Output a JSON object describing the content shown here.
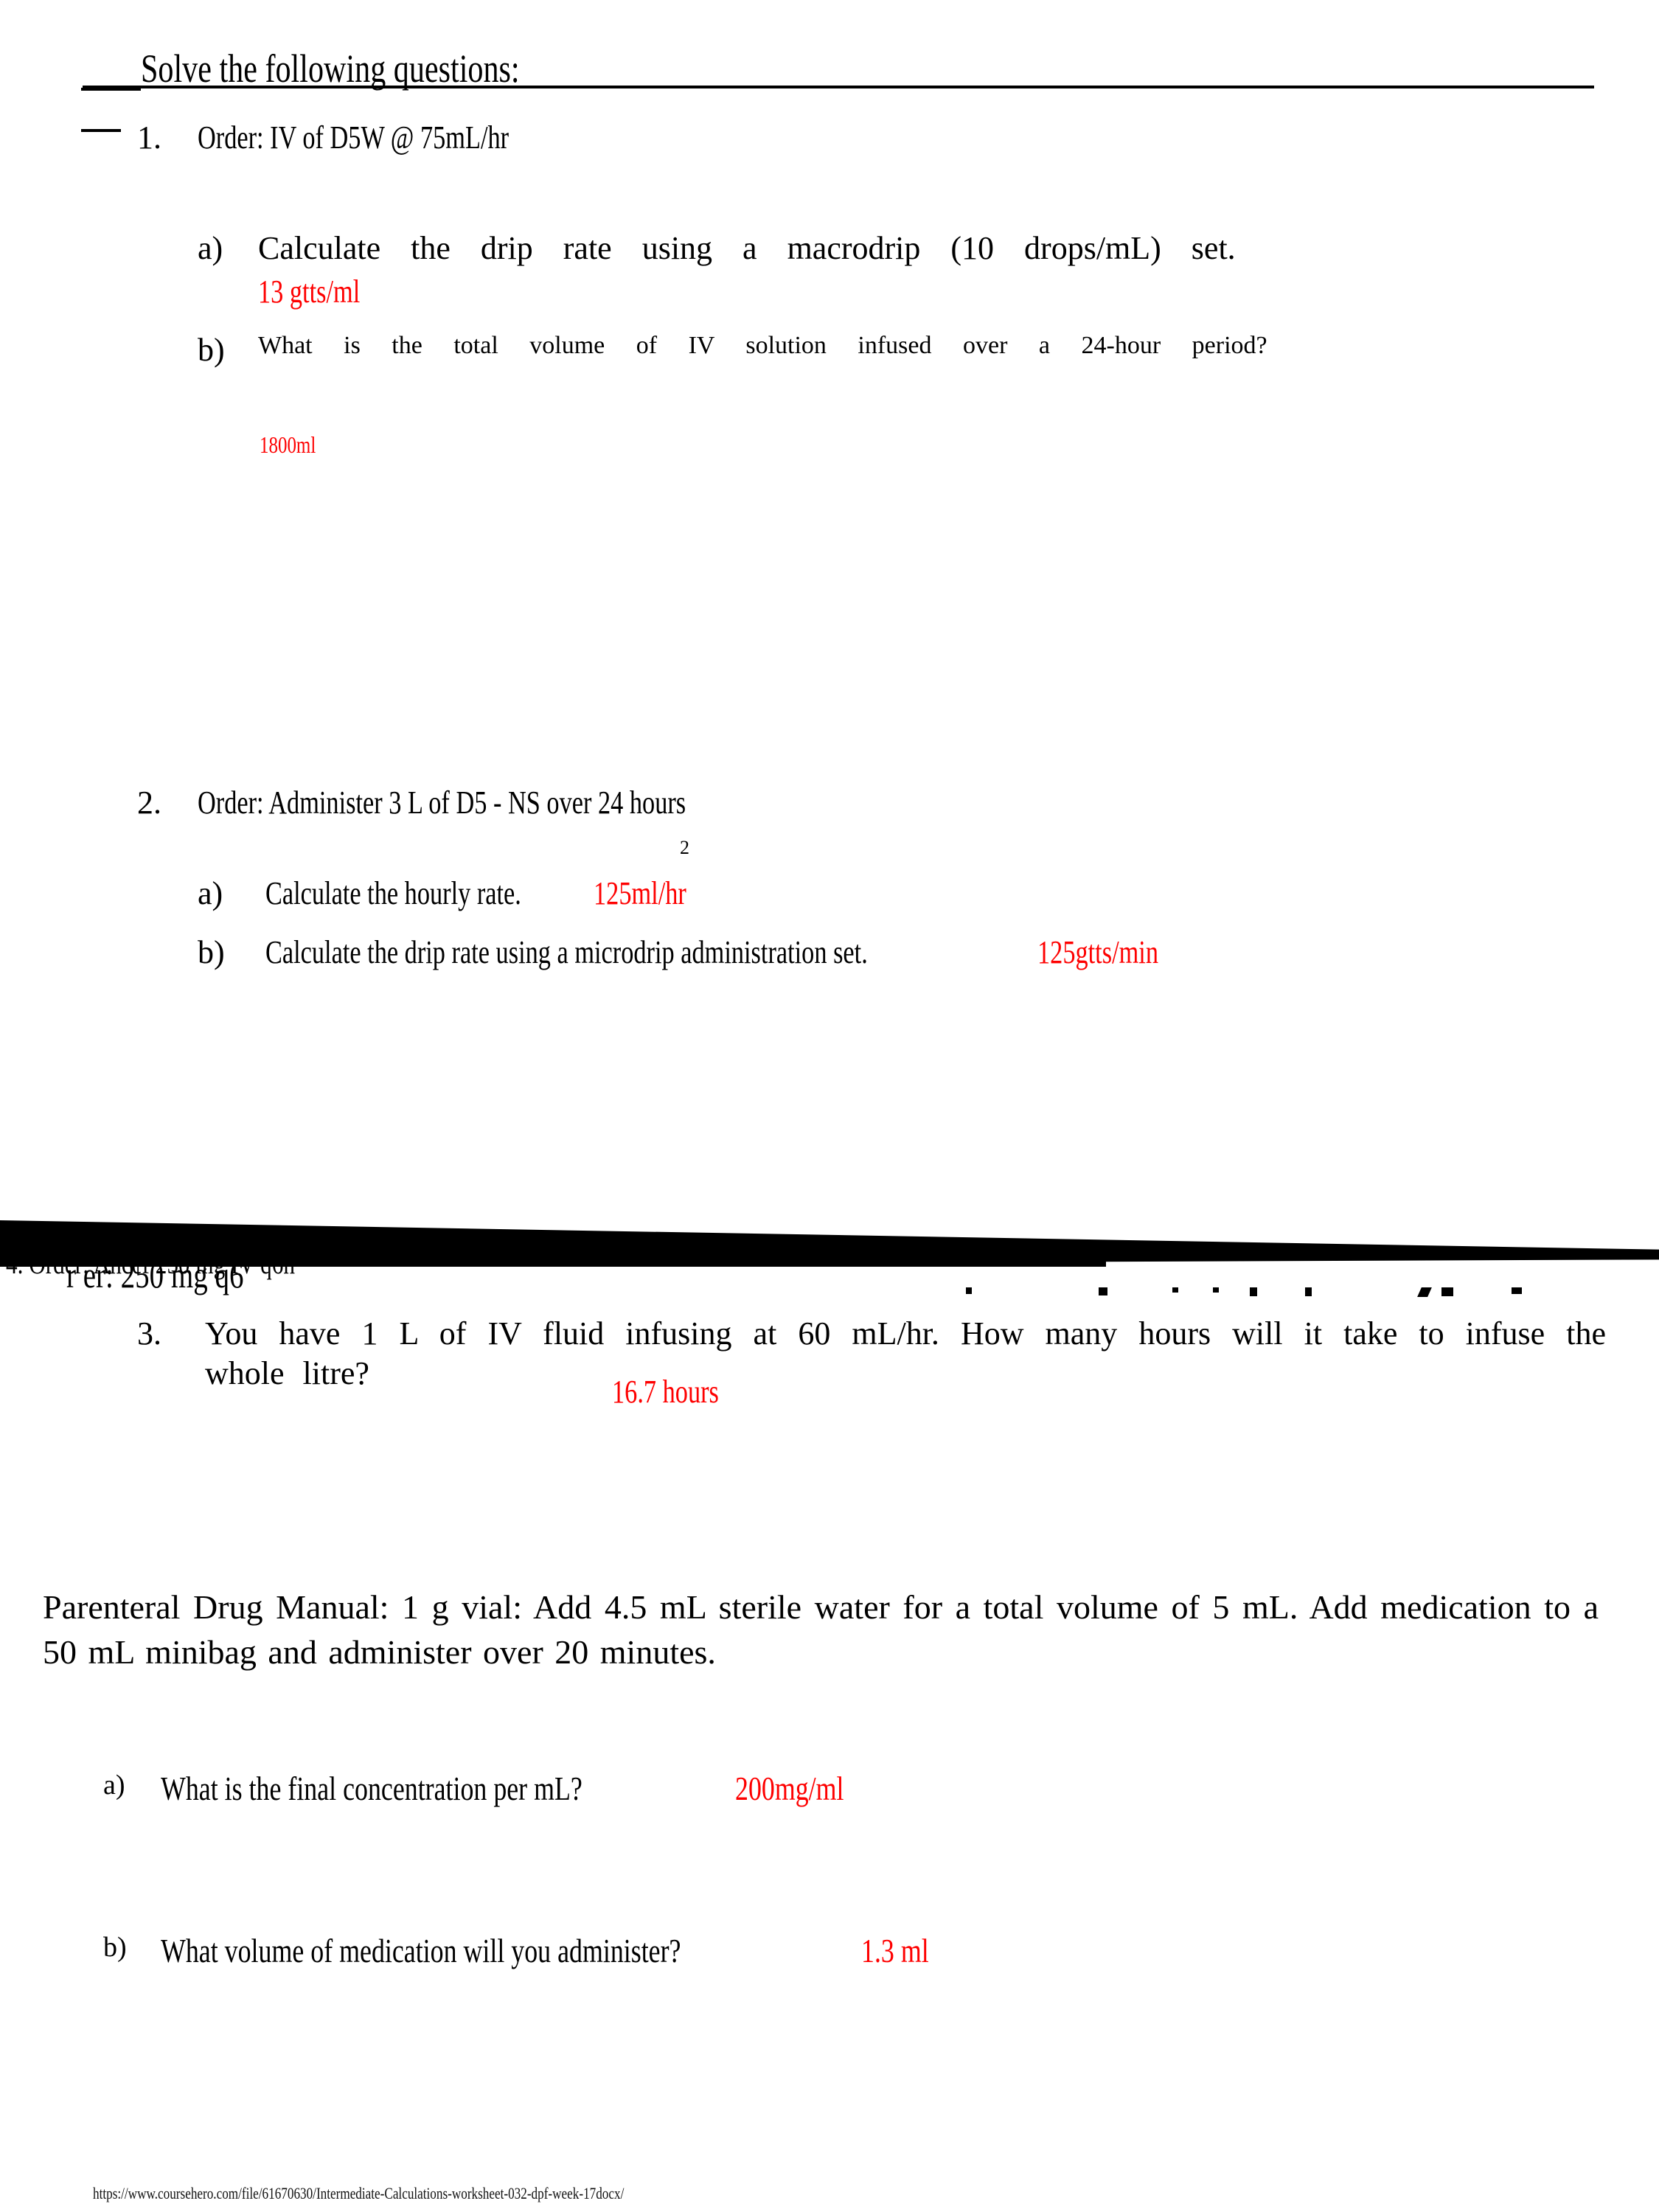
{
  "document": {
    "title": "Solve the following questions:",
    "answer_color": "#fe0000",
    "stray_mark": "2"
  },
  "questions": [
    {
      "number": "1.",
      "text": "Order: IV of D5W @ 75mL/hr",
      "parts": [
        {
          "label": "a)",
          "text": "Calculate the drip rate using a macrodrip (10 drops/mL) set.",
          "answer": "13 gtts/ml"
        },
        {
          "label": "b)",
          "text": "What is the total volume of IV solution infused over a 24-hour period?",
          "answer": "1800ml"
        }
      ]
    },
    {
      "number": "2.",
      "text": "Order: Administer 3 L of D5 - NS over 24 hours",
      "parts": [
        {
          "label": "a)",
          "text": "Calculate the hourly rate.",
          "answer": "125ml/hr"
        },
        {
          "label": "b)",
          "text": "Calculate the drip rate using a microdrip administration set.",
          "answer": "125gtts/min"
        }
      ]
    },
    {
      "number": "3.",
      "text": "You have 1 L of IV fluid infusing at 60 mL/hr. How many hours will it take to infuse the whole litre?",
      "answer": "16.7 hours"
    }
  ],
  "scan_artifact": {
    "overlap_line_1": "4.  Order: Ancef 250 mg IV q6h",
    "overlap_line_2": "r er:        250 mg    q6"
  },
  "manual": {
    "text": "Parenteral Drug Manual: 1 g vial: Add 4.5 mL sterile water for a total volume of 5 mL. Add medication to a 50 mL minibag and administer over 20 minutes.",
    "parts": [
      {
        "label": "a)",
        "text": "What is the final concentration per mL?",
        "answer": "200mg/ml"
      },
      {
        "label": "b)",
        "text": "What volume of medication will you administer?",
        "answer": "1.3 ml"
      }
    ]
  },
  "footer": {
    "url": "https://www.coursehero.com/file/61670630/Intermediate-Calculations-worksheet-032-dpf-week-17docx/"
  }
}
